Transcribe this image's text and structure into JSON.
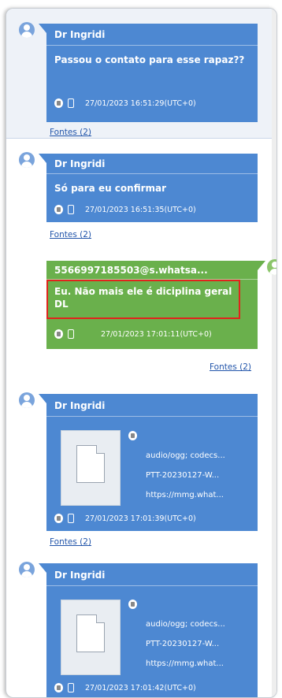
{
  "messages": [
    {
      "sender": "Dr Ingridi",
      "text": "Passou o contato para esse rapaz??",
      "timestamp": "27/01/2023 16:51:29(UTC+0)",
      "sources": "Fontes (2)",
      "highlighted_row": true
    },
    {
      "sender": "Dr Ingridi",
      "text": "Só para eu confirmar",
      "timestamp": "27/01/2023 16:51:35(UTC+0)",
      "sources": "Fontes (2)"
    },
    {
      "sender": "5566997185503@s.whatsa...",
      "text": "Eu. Não mais ele é diciplina geral DL",
      "timestamp": "27/01/2023 17:01:11(UTC+0)",
      "sources": "Fontes (2)",
      "outgoing": true,
      "marked": true
    },
    {
      "sender": "Dr Ingridi",
      "attachment": {
        "mime": "audio/ogg; codecs...",
        "filename": "PTT-20230127-W...",
        "url": "https://mmg.what..."
      },
      "timestamp": "27/01/2023 17:01:39(UTC+0)",
      "sources": "Fontes (2)"
    },
    {
      "sender": "Dr Ingridi",
      "attachment": {
        "mime": "audio/ogg; codecs...",
        "filename": "PTT-20230127-W...",
        "url": "https://mmg.what..."
      },
      "timestamp": "27/01/2023 17:01:42(UTC+0)"
    }
  ],
  "colors": {
    "incoming_bubble": "#4d88d2",
    "outgoing_bubble": "#6ab04c",
    "highlight_row": "#eef2f8",
    "marker": "#e0241c",
    "link": "#2255aa"
  },
  "icons": [
    "avatar-icon",
    "trash-icon",
    "phone-icon",
    "document-icon"
  ]
}
